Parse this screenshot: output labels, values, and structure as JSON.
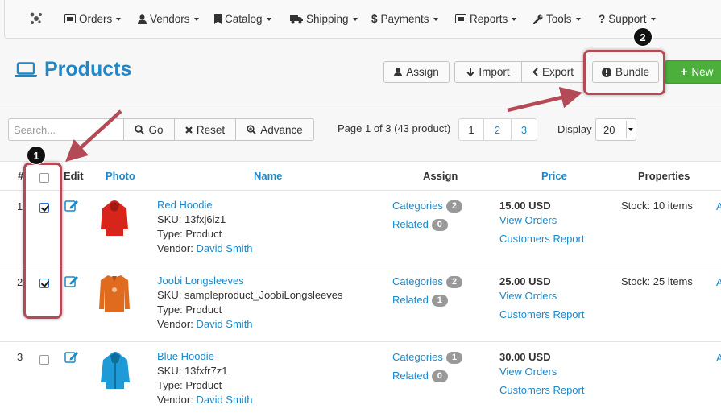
{
  "nav": {
    "items": [
      {
        "label": "Orders",
        "icon": "orders-icon"
      },
      {
        "label": "Vendors",
        "icon": "user-icon"
      },
      {
        "label": "Catalog",
        "icon": "bookmark-icon"
      },
      {
        "label": "Shipping",
        "icon": "truck-icon"
      },
      {
        "label": "Payments",
        "icon": "dollar-icon"
      },
      {
        "label": "Reports",
        "icon": "reports-icon"
      },
      {
        "label": "Tools",
        "icon": "wrench-icon"
      },
      {
        "label": "Support",
        "icon": "question-icon"
      }
    ]
  },
  "header": {
    "title": "Products",
    "buttons": {
      "assign": "Assign",
      "import": "Import",
      "export": "Export",
      "bundle": "Bundle",
      "new": "New"
    }
  },
  "search": {
    "placeholder": "Search...",
    "go": "Go",
    "reset": "Reset",
    "advance": "Advance"
  },
  "pagination": {
    "info": "Page 1 of 3 (43 product)",
    "pages": [
      "1",
      "2",
      "3"
    ],
    "display_label": "Display",
    "display_value": "20"
  },
  "table": {
    "columns": {
      "num": "#",
      "edit": "Edit",
      "photo": "Photo",
      "name": "Name",
      "assign": "Assign",
      "price": "Price",
      "properties": "Properties"
    },
    "rows": [
      {
        "num": "1",
        "checked": true,
        "name": "Red Hoodie",
        "sku": "SKU: 13fxj6iz1",
        "type": "Type: Product",
        "vendor_label": "Vendor:",
        "vendor": "David Smith",
        "categories_label": "Categories",
        "categories_count": "2",
        "related_label": "Related",
        "related_count": "0",
        "price": "15.00 USD",
        "view_orders": "View Orders",
        "customers_report": "Customers Report",
        "stock": "Stock: 10 items",
        "photo_color": "#d8251b"
      },
      {
        "num": "2",
        "checked": true,
        "name": "Joobi Longsleeves",
        "sku": "SKU: sampleproduct_JoobiLongsleeves",
        "type": "Type: Product",
        "vendor_label": "Vendor:",
        "vendor": "David Smith",
        "categories_label": "Categories",
        "categories_count": "2",
        "related_label": "Related",
        "related_count": "1",
        "price": "25.00 USD",
        "view_orders": "View Orders",
        "customers_report": "Customers Report",
        "stock": "Stock: 25 items",
        "photo_color": "#e06a1e"
      },
      {
        "num": "3",
        "checked": false,
        "name": "Blue Hoodie",
        "sku": "SKU: 13fxfr7z1",
        "type": "Type: Product",
        "vendor_label": "Vendor:",
        "vendor": "David Smith",
        "categories_label": "Categories",
        "categories_count": "1",
        "related_label": "Related",
        "related_count": "0",
        "price": "30.00 USD",
        "view_orders": "View Orders",
        "customers_report": "Customers Report",
        "stock": "",
        "photo_color": "#1e9ad6"
      }
    ]
  },
  "annotations": {
    "badge_1": "1",
    "badge_2": "2",
    "highlight_color": "#b34a55"
  },
  "colors": {
    "link": "#1e88c8",
    "new_button": "#4caf3c"
  }
}
